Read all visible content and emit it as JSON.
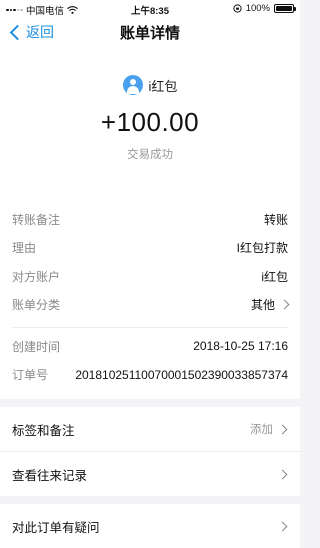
{
  "status_bar": {
    "carrier": "中国电信",
    "time": "上午8:35",
    "battery": "100%",
    "battery_level": 1.0
  },
  "nav": {
    "back_label": "返回",
    "title": "账单详情"
  },
  "summary": {
    "party_name": "i红包",
    "amount": "+100.00",
    "status": "交易成功"
  },
  "details": [
    {
      "label": "转账备注",
      "value": "转账"
    },
    {
      "label": "理由",
      "value": "I红包打款"
    },
    {
      "label": "对方账户",
      "value": "i红包"
    },
    {
      "label": "账单分类",
      "value": "其他"
    }
  ],
  "meta": {
    "created_label": "创建时间",
    "created_value": "2018-10-25 17:16",
    "order_label": "订单号",
    "order_value": "20181025110070001502390033857374"
  },
  "links": {
    "tags_label": "标签和备注",
    "tags_action": "添加",
    "history_label": "查看往来记录",
    "question_label": "对此订单有疑问"
  },
  "colors": {
    "accent": "#1d8fe1",
    "avatar": "#48a0ee",
    "background": "#f4f4f6"
  }
}
